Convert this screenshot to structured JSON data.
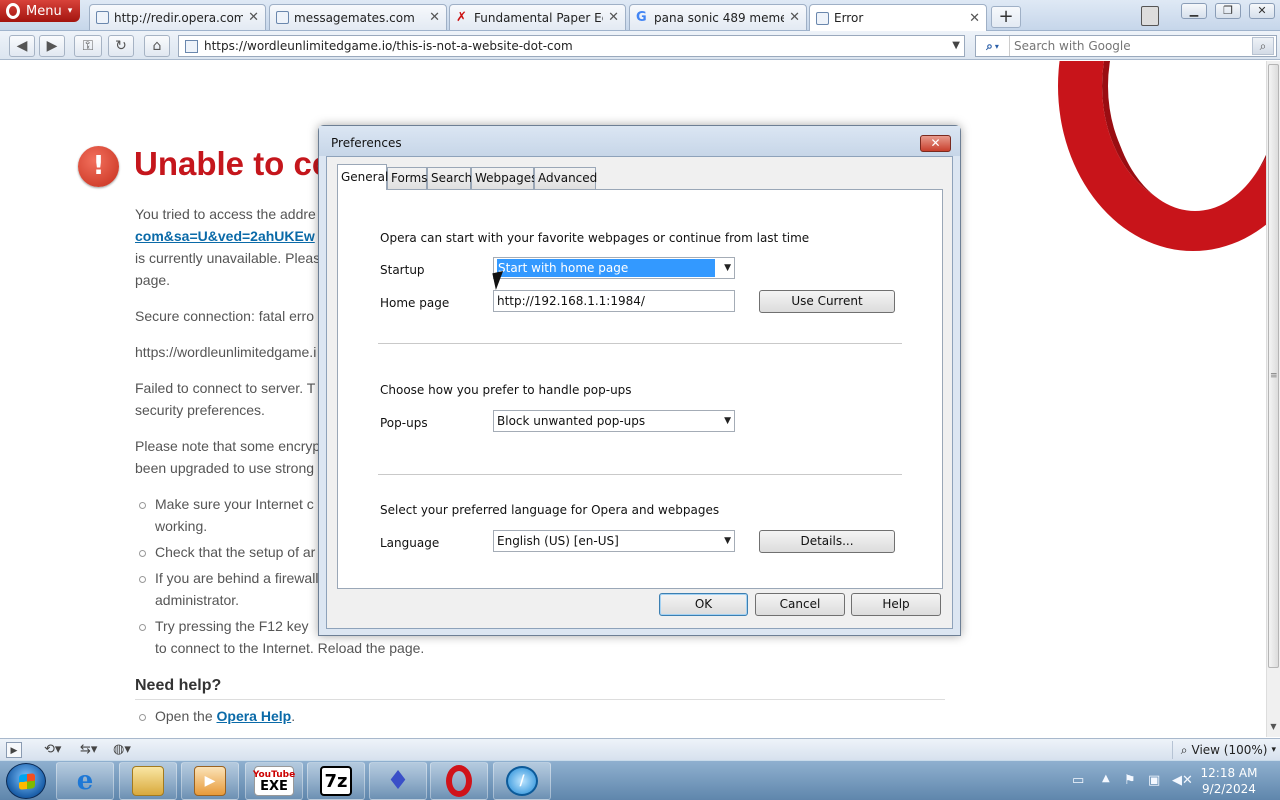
{
  "browser": {
    "menu_label": "Menu",
    "tabs": [
      {
        "label": "http://redir.opera.com...",
        "icon": "page-icon"
      },
      {
        "label": "messagemates.com",
        "icon": "page-icon"
      },
      {
        "label": "Fundamental Paper Ed...",
        "icon": "bookmark-icon"
      },
      {
        "label": "pana sonic 489 meme ...",
        "icon": "google-icon"
      },
      {
        "label": "Error",
        "icon": "page-icon"
      }
    ],
    "new_tab": "+",
    "url": "https://wordleunlimitedgame.io/this-is-not-a-website-dot-com",
    "search_placeholder": "Search with Google"
  },
  "error_page": {
    "title": "Unable to co",
    "p1_line1": "You tried to access the addre",
    "p1_link": "com&sa=U&ved=2ahUKEw",
    "p1_line3": "is currently unavailable. Pleas",
    "p1_line4": "page.",
    "secure": "Secure connection: fatal erro",
    "url_line": "https://wordleunlimitedgame.i",
    "failed_line1": "Failed to connect to server. T",
    "failed_line2": "security preferences.",
    "note_line1": "Please note that some encryp",
    "note_line2": "been upgraded to use strong",
    "bullets": [
      {
        "line1": "Make sure your Internet c",
        "line2": "working."
      },
      {
        "line1": "Check that the setup of ar",
        "line2": ""
      },
      {
        "line1": "If you are behind a firewall",
        "line2": "administrator."
      },
      {
        "line1": "Try pressing the F12 key",
        "line2": "to connect to the Internet. Reload the page."
      }
    ],
    "need_help": "Need help?",
    "help_prefix": "Open the ",
    "help_link": "Opera Help",
    "help_suffix": "."
  },
  "status": {
    "zoom": "View (100%)"
  },
  "taskbar": {
    "clock_time": "12:18 AM",
    "clock_date": "9/2/2024",
    "apps": [
      "internet-explorer",
      "file-explorer",
      "media-player",
      "youtube-exe",
      "7zip",
      "app-icon",
      "opera",
      "app-icon-2"
    ],
    "youtube_label_top": "YouTube",
    "youtube_label_bottom": "EXE",
    "sevenzip_label": "7z"
  },
  "preferences": {
    "title": "Preferences",
    "tabs": [
      "General",
      "Forms",
      "Search",
      "Webpages",
      "Advanced"
    ],
    "active_tab": "General",
    "startup_intro": "Opera can start with your favorite webpages or continue from last time",
    "startup_label": "Startup",
    "startup_value": "Start with home page",
    "homepage_label": "Home page",
    "homepage_value": "http://192.168.1.1:1984/",
    "use_current": "Use Current",
    "popups_intro": "Choose how you prefer to handle pop-ups",
    "popups_label": "Pop-ups",
    "popups_value": "Block unwanted pop-ups",
    "language_intro": "Select your preferred language for Opera and webpages",
    "language_label": "Language",
    "language_value": "English (US) [en-US]",
    "details": "Details...",
    "ok": "OK",
    "cancel": "Cancel",
    "help": "Help"
  },
  "colors": {
    "opera_red": "#c8141a",
    "error_title": "#c5161c",
    "link": "#0a6aa8",
    "selection": "#3399ff"
  }
}
